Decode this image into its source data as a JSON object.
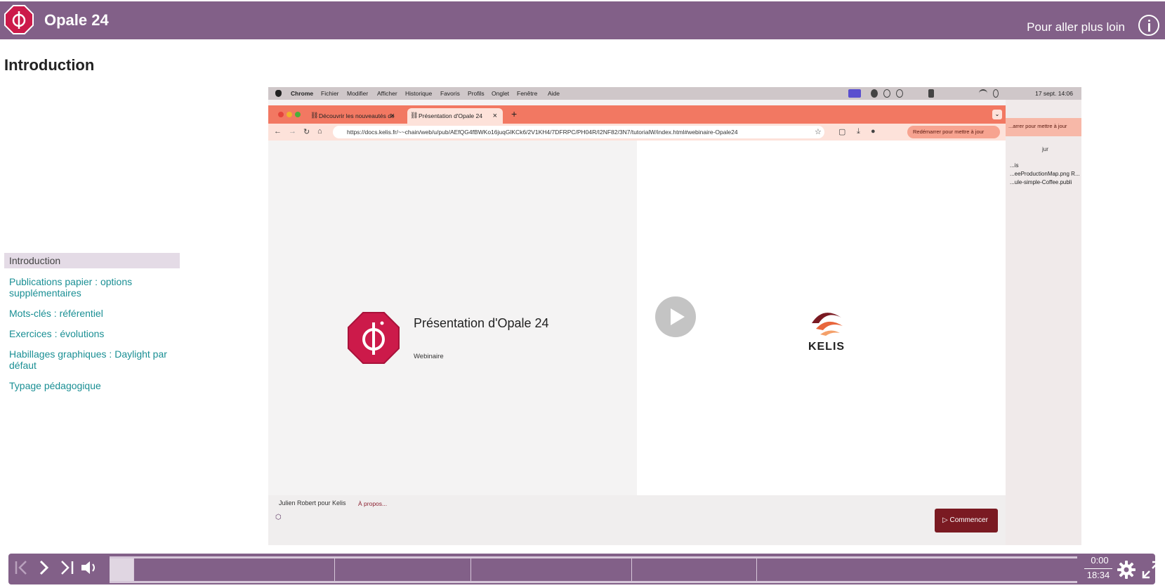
{
  "header": {
    "title": "Opale 24",
    "more_link": "Pour aller plus loin"
  },
  "page": {
    "title": "Introduction"
  },
  "outline": {
    "items": [
      {
        "label": "Introduction",
        "active": true
      },
      {
        "label": "Publications papier : options supplémentaires",
        "active": false
      },
      {
        "label": "Mots-clés : référentiel",
        "active": false
      },
      {
        "label": "Exercices : évolutions",
        "active": false
      },
      {
        "label": "Habillages graphiques : Daylight par défaut",
        "active": false
      },
      {
        "label": "Typage pédagogique",
        "active": false
      }
    ]
  },
  "video": {
    "menubar": {
      "app": "Chrome",
      "menus": [
        "Fichier",
        "Modifier",
        "Afficher",
        "Historique",
        "Favoris",
        "Profils",
        "Onglet",
        "Fenêtre",
        "Aide"
      ],
      "clock": "17 sept. 14:06"
    },
    "tabs": {
      "inactive_label": "Découvrir les nouveautés de",
      "active_label": "Présentation d'Opale 24"
    },
    "url": "https://docs.kelis.fr/~~chain/web/u/pub/AEfQG4fBWKo16juqGlKCk6/2V1KH4/7DFRPC/PH04R/I2NF82/3N7/tutorialW/index.html#webinaire-Opale24",
    "restart_label": "Redémarrer pour mettre à jour",
    "slide": {
      "title": "Présentation d'Opale 24",
      "subtitle": "Webinaire",
      "brand": "KELIS",
      "author": "Julien Robert pour Kelis",
      "about": "À propos...",
      "start_button": "Commencer"
    },
    "background_window": {
      "restart_label": "...arrer pour mettre à jour",
      "profile": "jur",
      "files": [
        "...is",
        "...eeProductionMap.png R...",
        "...ule-simple-Coffee.publi"
      ]
    }
  },
  "player": {
    "current_time": "0:00",
    "total_time": "18:34",
    "progress_fraction": 0.025,
    "chapter_marks": [
      0.025,
      0.232,
      0.373,
      0.539,
      0.668
    ]
  },
  "colors": {
    "brand_purple": "#826088",
    "link_teal": "#1a8f94",
    "opale_red": "#cc1a4a",
    "start_button": "#7a1a22"
  },
  "icons": {
    "first": "skip-first-icon",
    "next": "next-icon",
    "last": "skip-last-icon",
    "volume": "volume-icon",
    "settings": "gear-icon",
    "fullscreen": "fullscreen-icon",
    "info": "info-icon"
  }
}
